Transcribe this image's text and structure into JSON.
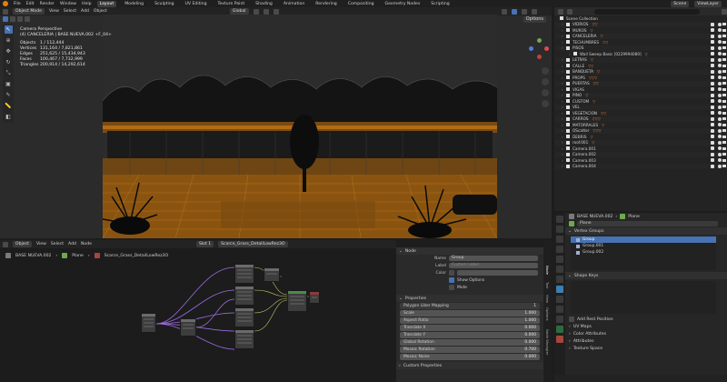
{
  "topbar": {
    "menus": [
      "File",
      "Edit",
      "Render",
      "Window",
      "Help"
    ],
    "workspaces": [
      "Layout",
      "Modeling",
      "Sculpting",
      "UV Editing",
      "Texture Paint",
      "Shading",
      "Animation",
      "Rendering",
      "Compositing",
      "Geometry Nodes",
      "Scripting"
    ],
    "active_workspace": "Layout",
    "scene": "Scene",
    "view_layer": "ViewLayer"
  },
  "viewport": {
    "mode": "Object Mode",
    "menus": [
      "View",
      "Select",
      "Add",
      "Object"
    ],
    "transform": "Global",
    "options": "Options",
    "stats": {
      "title": "Camera Perspective",
      "subtitle": "(4) CANCELERIA | BASE NUEVA.002 +F_04+",
      "rows": [
        {
          "k": "Objects",
          "v": "1 / 112,444"
        },
        {
          "k": "Vertices",
          "v": "131,164 / 7,821,861"
        },
        {
          "k": "Edges",
          "v": "251,625 / 15,434,943"
        },
        {
          "k": "Faces",
          "v": "100,467 / 7,732,999"
        },
        {
          "k": "Triangles",
          "v": "200,914 / 14,292,614"
        }
      ]
    }
  },
  "outliner": {
    "title": "Scene Collection",
    "items": [
      {
        "label": "VIDRIOS",
        "tris": "▽▽"
      },
      {
        "label": "MUROS",
        "tris": "▽"
      },
      {
        "label": "CANCELERIA",
        "tris": "▽"
      },
      {
        "label": "TECHUMBRES",
        "tris": "▽▽"
      },
      {
        "label": "PISOS",
        "tris": ""
      },
      {
        "label": "Wall Sweep Basic [0229994080]",
        "tris": "▽"
      },
      {
        "label": "LETRAS",
        "tris": "▽"
      },
      {
        "label": "CALLE",
        "tris": "▽▽"
      },
      {
        "label": "BANQUETA",
        "tris": "▽"
      },
      {
        "label": "PROPS",
        "tris": "▽▽▽"
      },
      {
        "label": "PUERTAS",
        "tris": "▽▽"
      },
      {
        "label": "VIGAS",
        "tris": ""
      },
      {
        "label": "PINO",
        "tris": "▽"
      },
      {
        "label": "CUSTOM",
        "tris": "▽"
      },
      {
        "label": "VEL",
        "tris": ""
      },
      {
        "label": "VEGETACION",
        "tris": "▽▽"
      },
      {
        "label": "CARROS",
        "tris": "▽▽▽"
      },
      {
        "label": "MATORRALES",
        "tris": "▽"
      },
      {
        "label": "OScatter",
        "tris": "▽▽▽"
      },
      {
        "label": "DEBRIS",
        "tris": "▽"
      },
      {
        "label": "roof.001",
        "tris": "▽"
      },
      {
        "label": "Camera.001",
        "tris": ""
      },
      {
        "label": "Camera.002",
        "tris": ""
      },
      {
        "label": "Camera.003",
        "tris": ""
      },
      {
        "label": "Camera.004",
        "tris": ""
      }
    ]
  },
  "properties": {
    "breadcrumb": [
      "BASE NUEVA.002",
      "Plane"
    ],
    "object_name": "Plane",
    "vertex_groups_title": "Vertex Groups",
    "vertex_groups": [
      "Group",
      "Group.001",
      "Group.002"
    ],
    "shape_keys_title": "Shape Keys",
    "add_rest": "Add Rest Position",
    "sections": [
      "UV Maps",
      "Color Attributes",
      "Attributes",
      "Texture Space"
    ]
  },
  "node_editor": {
    "type": "Object",
    "menus": [
      "View",
      "Select",
      "Add",
      "Node"
    ],
    "slot": "Slot 1",
    "material": "Scarce_Grass_DetailLowRez3O",
    "breadcrumb": [
      "BASE NUEVA.002",
      "Plane",
      "Scarce_Grass_DetailLowRez3O"
    ]
  },
  "node_sidebar": {
    "node_header": "Node",
    "name_label": "Name",
    "name_value": "Group",
    "label_label": "Label",
    "label_placeholder": "Custom Label",
    "color_label": "Color",
    "show_options": "Show Options",
    "mute": "Mute",
    "properties_header": "Properties",
    "mapping": "Polygon Liber Mapping",
    "mapping_value": "1",
    "params": [
      {
        "k": "Scale",
        "v": "1.000"
      },
      {
        "k": "Aspect Ratio",
        "v": "1.000"
      },
      {
        "k": "Translate X",
        "v": "0.000"
      },
      {
        "k": "Translate Y",
        "v": "0.000"
      },
      {
        "k": "Global Rotation",
        "v": "0.000"
      },
      {
        "k": "Mosaic Rotation",
        "v": "0.700"
      },
      {
        "k": "Mosaic Noise",
        "v": "0.000"
      }
    ],
    "custom_props": "Custom Properties",
    "tabs": [
      "Node",
      "Tool",
      "View",
      "Options",
      "Node Wrangler"
    ]
  }
}
